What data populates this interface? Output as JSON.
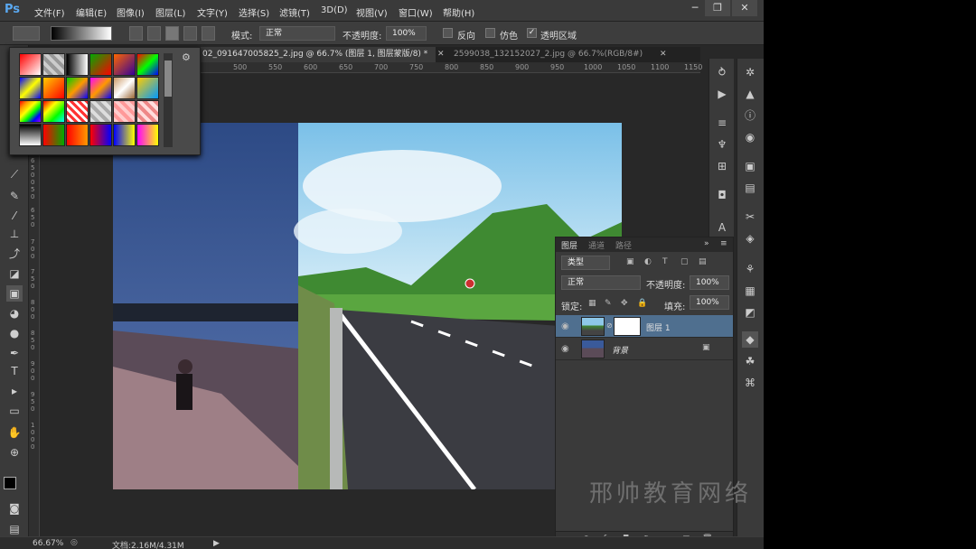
{
  "app": {
    "logo": "Ps"
  },
  "menu": [
    "文件(F)",
    "编辑(E)",
    "图像(I)",
    "图层(L)",
    "文字(Y)",
    "选择(S)",
    "滤镜(T)",
    "3D(D)",
    "视图(V)",
    "窗口(W)",
    "帮助(H)"
  ],
  "window_controls": {
    "minimize": "─",
    "restore": "❐",
    "close": "✕"
  },
  "options": {
    "mode_label": "模式:",
    "mode_value": "正常",
    "opacity_label": "不透明度:",
    "opacity_value": "100%",
    "reverse_label": "反向",
    "dither_label": "仿色",
    "transparency_label": "透明区域"
  },
  "tabs": [
    {
      "label": "02_091647005825_2.jpg @ 66.7% (图层 1, 图层蒙版/8) *",
      "active": true
    },
    {
      "label": "2599038_132152027_2.jpg @ 66.7%(RGB/8#)",
      "active": false
    }
  ],
  "ruler_h": [
    "500",
    "550",
    "600",
    "650",
    "700",
    "750",
    "800",
    "850",
    "900",
    "950",
    "1000",
    "1050",
    "1100",
    "1150"
  ],
  "ruler_v": [
    "6",
    "5",
    "0",
    "0",
    "5",
    "0",
    "6",
    "5",
    "0",
    "7",
    "0",
    "0",
    "7",
    "5",
    "0",
    "8",
    "0",
    "0",
    "8",
    "5",
    "0",
    "9",
    "0",
    "0",
    "9",
    "5",
    "0",
    "1",
    "0",
    "0",
    "0"
  ],
  "layers_panel": {
    "tabs": [
      "图层",
      "通道",
      "路径"
    ],
    "filter_label": "类型",
    "blend_mode": "正常",
    "opacity_label": "不透明度:",
    "opacity_value": "100%",
    "lock_label": "锁定:",
    "fill_label": "填充:",
    "fill_value": "100%",
    "layers": [
      {
        "name": "图层 1",
        "selected": true
      },
      {
        "name": "背景",
        "selected": false
      }
    ]
  },
  "status": {
    "zoom": "66.67%",
    "doc": "文档:2.16M/4.31M"
  },
  "watermark": "邢帅教育网络",
  "colors": {
    "accent": "#5aa8f0",
    "selected_layer": "#4f6f8f"
  }
}
